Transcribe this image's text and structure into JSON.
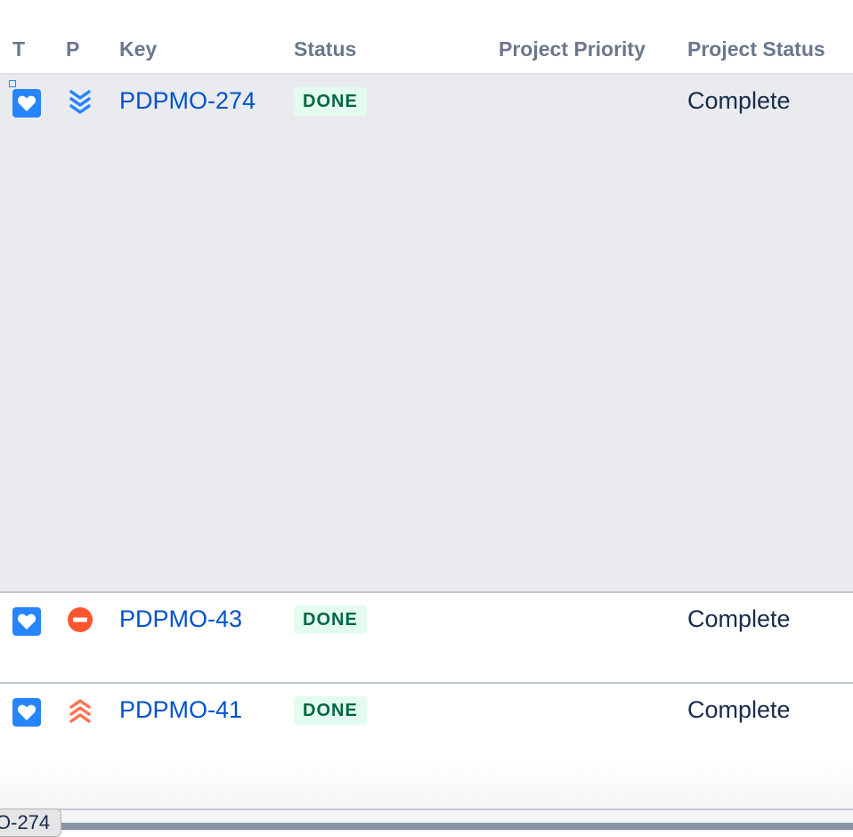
{
  "columns": {
    "type": "T",
    "priority": "P",
    "key": "Key",
    "status": "Status",
    "project_priority": "Project Priority",
    "project_status": "Project Status"
  },
  "rows": [
    {
      "type_icon": "heart-icon",
      "priority_icon": "lowest-priority-icon",
      "key": "PDPMO-274",
      "status": "DONE",
      "project_priority": "",
      "project_status": "Complete",
      "selected": true
    },
    {
      "type_icon": "heart-icon",
      "priority_icon": "blocker-priority-icon",
      "key": "PDPMO-43",
      "status": "DONE",
      "project_priority": "",
      "project_status": "Complete",
      "selected": false
    },
    {
      "type_icon": "heart-icon",
      "priority_icon": "highest-priority-icon",
      "key": "PDPMO-41",
      "status": "DONE",
      "project_priority": "",
      "project_status": "Complete",
      "selected": false
    }
  ],
  "tooltip": "O-274",
  "colors": {
    "link": "#0052cc",
    "type_icon_bg": "#2684ff",
    "done_bg": "#e3fcef",
    "done_text": "#006644",
    "lowest_priority": "#2684ff",
    "blocker_priority": "#ff5630",
    "highest_priority": "#ff7452",
    "selected_row_bg": "#e9ebef"
  }
}
